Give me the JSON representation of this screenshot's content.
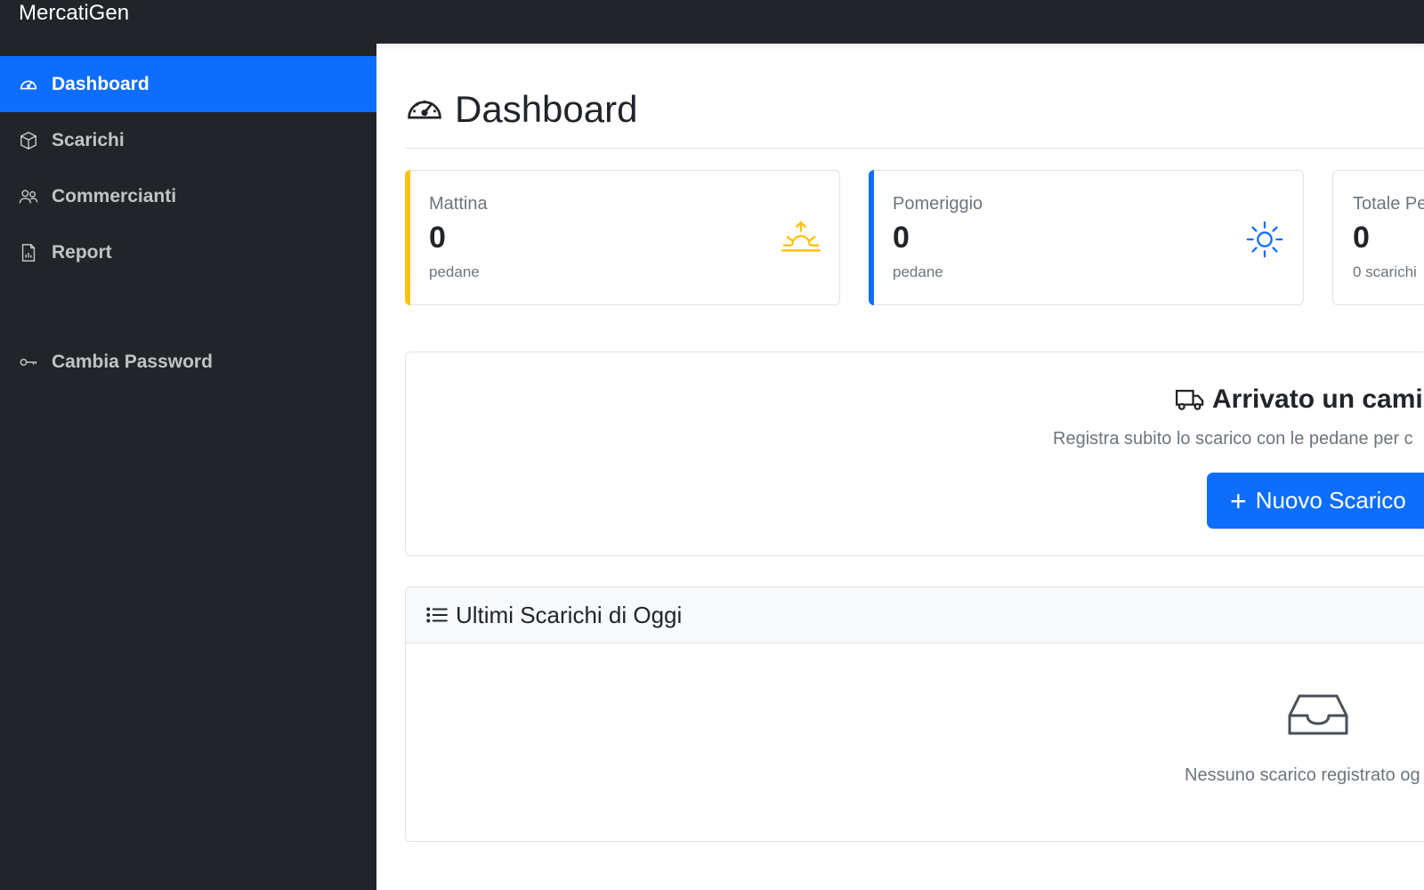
{
  "app": {
    "brand": "MercatiGen"
  },
  "sidebar": {
    "items": [
      {
        "label": "Dashboard",
        "icon": "speedometer-icon",
        "active": true
      },
      {
        "label": "Scarichi",
        "icon": "box-icon",
        "active": false
      },
      {
        "label": "Commercianti",
        "icon": "people-icon",
        "active": false
      },
      {
        "label": "Report",
        "icon": "report-icon",
        "active": false
      },
      {
        "label": "Cambia Password",
        "icon": "key-icon",
        "active": false
      }
    ]
  },
  "page": {
    "title": "Dashboard",
    "icon": "speedometer-icon"
  },
  "stats": [
    {
      "label": "Mattina",
      "value": "0",
      "sub": "pedane",
      "icon": "sunrise-icon",
      "accent": "#ffc107"
    },
    {
      "label": "Pomeriggio",
      "value": "0",
      "sub": "pedane",
      "icon": "sun-icon",
      "accent": "#0d6efd"
    },
    {
      "label": "Totale Pe",
      "value": "0",
      "sub": "0 scarichi",
      "accent": "#dee2e6"
    }
  ],
  "cta": {
    "title": "Arrivato un camic",
    "text": "Registra subito lo scarico con le pedane per c",
    "button_label": "Nuovo Scarico",
    "icon": "truck-icon"
  },
  "recent": {
    "title": "Ultimi Scarichi di Oggi",
    "icon": "list-icon",
    "empty_icon": "inbox-icon",
    "empty_text": "Nessuno scarico registrato og"
  },
  "colors": {
    "primary": "#0d6efd",
    "sidebar": "#212529",
    "warning": "#ffc107"
  }
}
